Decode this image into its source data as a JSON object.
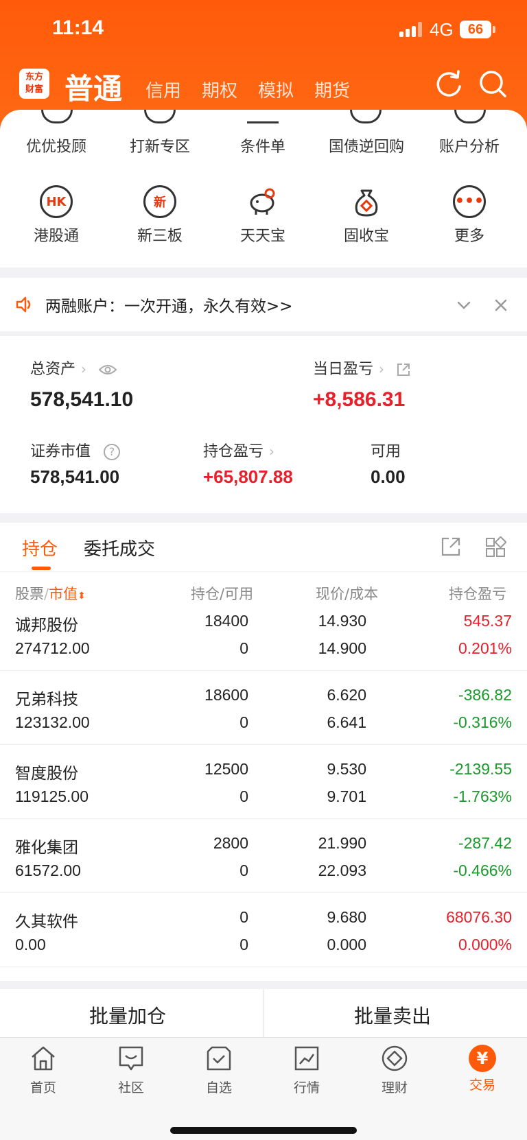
{
  "status": {
    "time": "11:14",
    "network": "4G",
    "battery": "66"
  },
  "nav": {
    "logo_line1": "东方",
    "logo_line2": "财富",
    "main": "普通",
    "items": [
      "信用",
      "期权",
      "模拟",
      "期货"
    ]
  },
  "quick_row1": [
    "优优投顾",
    "打新专区",
    "条件单",
    "国债逆回购",
    "账户分析"
  ],
  "quick_row2": [
    {
      "label": "港股通",
      "icon": "HK"
    },
    {
      "label": "新三板",
      "icon": "新"
    },
    {
      "label": "天天宝",
      "icon": "piggy-bank-icon"
    },
    {
      "label": "固收宝",
      "icon": "money-bag-icon"
    },
    {
      "label": "更多",
      "icon": "more-icon"
    }
  ],
  "notice": {
    "text": "两融账户：一次开通，永久有效>>"
  },
  "assets": {
    "total_label": "总资产",
    "total_value": "578,541.10",
    "daily_label": "当日盈亏",
    "daily_value": "+8,586.31",
    "market_label": "证券市值",
    "market_value": "578,541.00",
    "holding_label": "持仓盈亏",
    "holding_value": "+65,807.88",
    "avail_label": "可用",
    "avail_value": "0.00"
  },
  "tabs": {
    "active": "持仓",
    "other": "委托成交"
  },
  "columns": {
    "c1a": "股票",
    "c1b": "市值",
    "c2": "持仓/可用",
    "c3": "现价/成本",
    "c4": "持仓盈亏"
  },
  "rows": [
    {
      "name": "诚邦股份",
      "value": "274712.00",
      "hold": "18400",
      "avail": "0",
      "price": "14.930",
      "cost": "14.900",
      "pnl": "545.37",
      "pct": "0.201%",
      "color": "#e8202a"
    },
    {
      "name": "兄弟科技",
      "value": "123132.00",
      "hold": "18600",
      "avail": "0",
      "price": "6.620",
      "cost": "6.641",
      "pnl": "-386.82",
      "pct": "-0.316%",
      "color": "#1a9a2a"
    },
    {
      "name": "智度股份",
      "value": "119125.00",
      "hold": "12500",
      "avail": "0",
      "price": "9.530",
      "cost": "9.701",
      "pnl": "-2139.55",
      "pct": "-1.763%",
      "color": "#1a9a2a"
    },
    {
      "name": "雅化集团",
      "value": "61572.00",
      "hold": "2800",
      "avail": "0",
      "price": "21.990",
      "cost": "22.093",
      "pnl": "-287.42",
      "pct": "-0.466%",
      "color": "#1a9a2a"
    },
    {
      "name": "久其软件",
      "value": "0.00",
      "hold": "0",
      "avail": "0",
      "price": "9.680",
      "cost": "0.000",
      "pnl": "68076.30",
      "pct": "0.000%",
      "color": "#e8202a"
    }
  ],
  "actions": {
    "buy": "批量加仓",
    "sell": "批量卖出"
  },
  "tabbar": [
    {
      "label": "首页",
      "icon": "home-icon"
    },
    {
      "label": "社区",
      "icon": "chat-icon"
    },
    {
      "label": "自选",
      "icon": "checkbox-icon"
    },
    {
      "label": "行情",
      "icon": "chart-icon"
    },
    {
      "label": "理财",
      "icon": "diamond-icon"
    },
    {
      "label": "交易",
      "icon": "yuan-icon",
      "active": true
    }
  ],
  "colors": {
    "brand": "#ff5a0a",
    "up": "#e8202a",
    "down": "#1a9a2a"
  }
}
